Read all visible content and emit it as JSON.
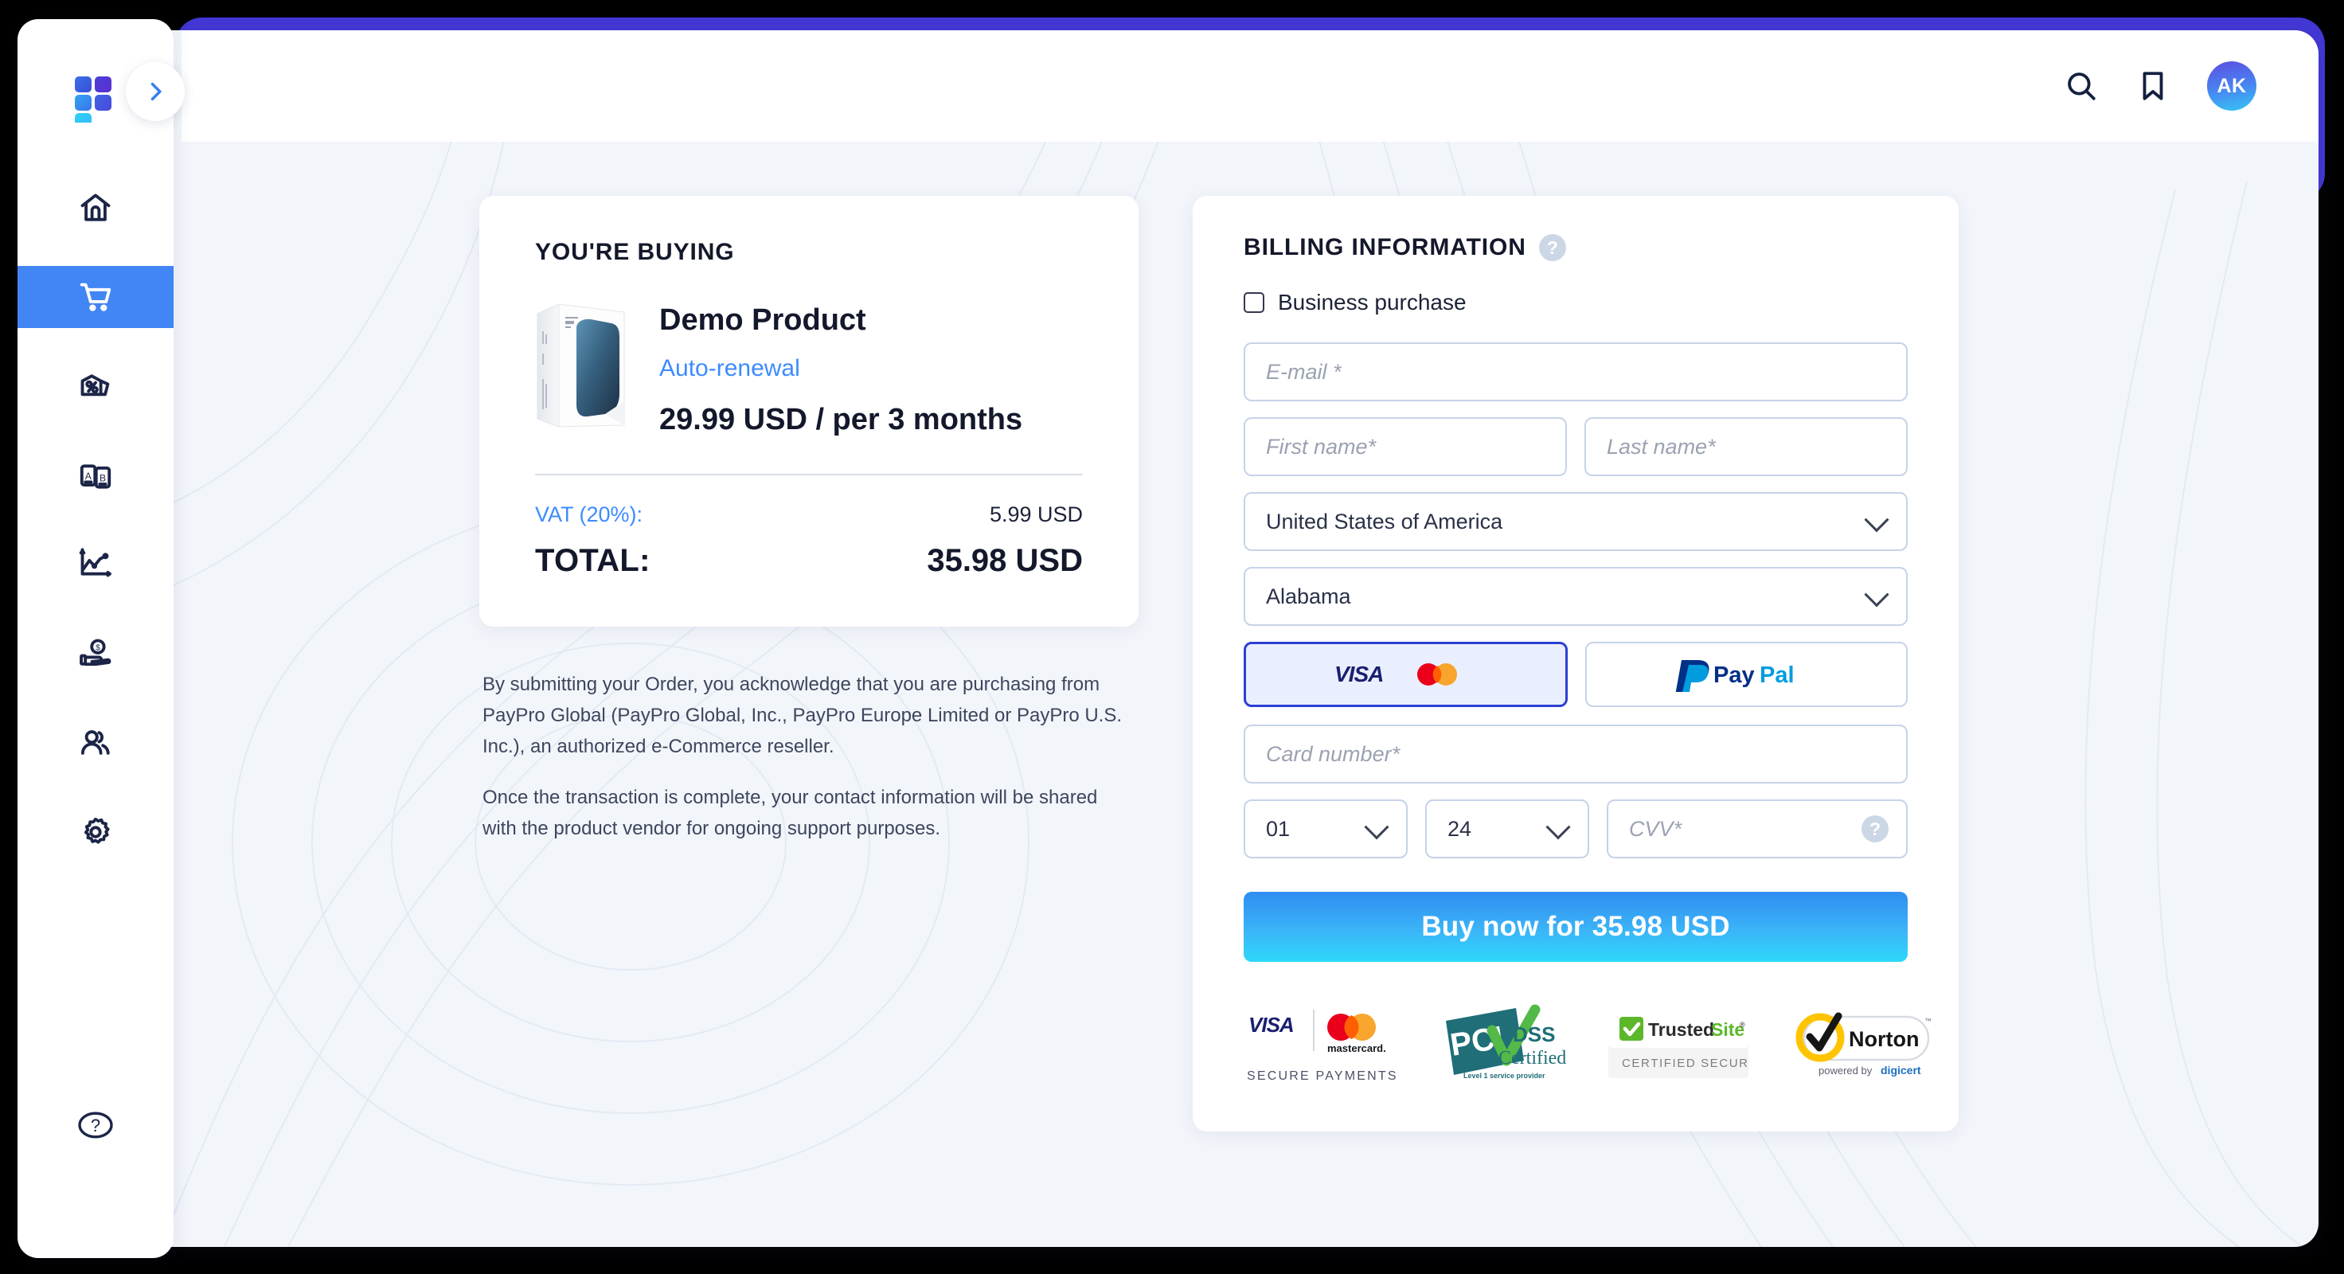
{
  "app": {
    "brand_logo": "paypro-logo",
    "accent_blue": "#4285f4",
    "indigo": "#4338d6",
    "avatar_initials": "AK"
  },
  "sidebar": {
    "expand_toggle_icon": "chevron-right-icon",
    "items": [
      {
        "key": "home",
        "icon": "home-icon",
        "active": false
      },
      {
        "key": "orders",
        "icon": "shopping-cart-icon",
        "active": true
      },
      {
        "key": "discounts",
        "icon": "price-tag-percent-icon",
        "active": false
      },
      {
        "key": "catalog",
        "icon": "ab-cards-icon",
        "active": false
      },
      {
        "key": "analytics",
        "icon": "line-chart-icon",
        "active": false
      },
      {
        "key": "payouts",
        "icon": "hand-coin-icon",
        "active": false
      },
      {
        "key": "customers",
        "icon": "users-icon",
        "active": false
      },
      {
        "key": "settings",
        "icon": "gear-icon",
        "active": false
      }
    ],
    "help": {
      "key": "help",
      "icon": "question-circle-icon"
    }
  },
  "topbar": {
    "search_icon": "search-icon",
    "bookmark_icon": "bookmark-icon",
    "avatar": "AK"
  },
  "order": {
    "heading": "YOU'RE BUYING",
    "product_image": "product-box-mockup",
    "product_name": "Demo Product",
    "renewal": "Auto-renewal",
    "price": "29.99 USD / per 3 months",
    "vat_label": "VAT (20%):",
    "vat_value": "5.99 USD",
    "total_label": "TOTAL:",
    "total_value": "35.98 USD"
  },
  "legal": {
    "paragraph_1": "By submitting your Order, you acknowledge that you are purchasing from PayPro Global (PayPro Global, Inc., PayPro Europe Limited or PayPro U.S. Inc.), an authorized e-Commerce reseller.",
    "paragraph_2": "Once the transaction is complete, your contact information will be shared with the product vendor for ongoing support purposes."
  },
  "billing": {
    "heading": "BILLING INFORMATION",
    "help_icon": "question-mark-icon",
    "help_glyph": "?",
    "business_purchase_label": "Business purchase",
    "business_purchase_checked": false,
    "fields": {
      "email_placeholder": "E-mail *",
      "email_value": "",
      "first_name_placeholder": "First name*",
      "first_name_value": "",
      "last_name_placeholder": "Last name*",
      "last_name_value": "",
      "country_value": "United States of America",
      "state_value": "Alabama",
      "card_number_placeholder": "Card number*",
      "card_number_value": "",
      "exp_month_value": "01",
      "exp_year_value": "24",
      "cvv_placeholder": "CVV*",
      "cvv_value": "",
      "cvv_help_glyph": "?"
    },
    "payment_methods": [
      {
        "key": "card",
        "label": "VISA / mastercard",
        "selected": true
      },
      {
        "key": "paypal",
        "label": "PayPal",
        "selected": false
      }
    ],
    "buy_button_label": "Buy now for 35.98 USD"
  },
  "trust_badges": [
    {
      "key": "visa-mastercard",
      "caption": "SECURE PAYMENTS",
      "visa": "VISA",
      "mastercard": "mastercard."
    },
    {
      "key": "pci-dss",
      "line1": "PCI",
      "line2": "DSS",
      "line3": "Certified",
      "line4": "Level 1 service provider"
    },
    {
      "key": "trustedsite",
      "line1": "Trusted",
      "line2": "Site",
      "line3": "CERTIFIED SECURE"
    },
    {
      "key": "norton",
      "line1": "Norton",
      "line2": "powered by ",
      "line3": "digicert"
    }
  ]
}
